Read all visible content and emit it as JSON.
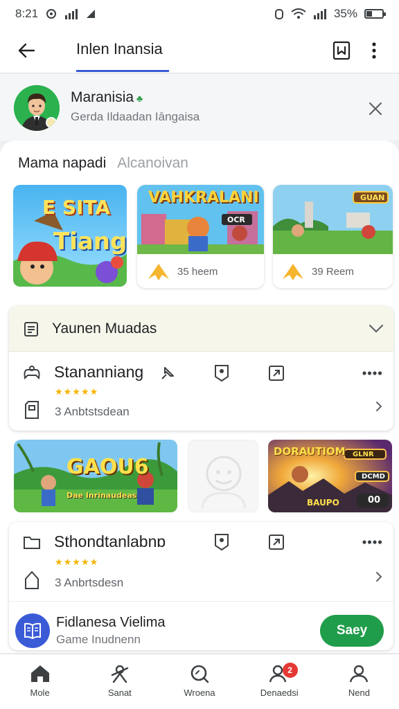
{
  "status_bar": {
    "time": "8:21",
    "battery": "35%",
    "battery_level": 0.35
  },
  "app_bar": {
    "title": "Inlen Inansia"
  },
  "profile": {
    "name": "Maranisia",
    "subtitle": "Gerda Ildaadan Iāngaisa"
  },
  "tabs": [
    {
      "label": "Mama napadi",
      "active": true
    },
    {
      "label": "Alcanoivan",
      "active": false
    }
  ],
  "featured": [
    {
      "title_line1": "E SITA",
      "title_line2": "Tiang"
    },
    {
      "title": "VAHKRALANI",
      "tag": "OCR",
      "rating": "35 heem"
    },
    {
      "tag": "GUAN",
      "rating": "39 Reem"
    }
  ],
  "section": {
    "header": "Yaunen Muadas"
  },
  "apps": [
    {
      "name": "Stananniang",
      "rating_stars": 5,
      "subtitle": "3 Anbtstsdean"
    },
    {
      "name": "Sthondtanlabnɒ",
      "rating_stars": 5,
      "subtitle": "3 Anbrtsdesn"
    }
  ],
  "gallery": [
    {
      "title": "GAOU6",
      "caption": "Dae Inrinaudeas"
    },
    {
      "title": ""
    },
    {
      "title": "DORAUTIOM",
      "tag": "GLNR",
      "tag2": "DCMD",
      "tag3": "BAUPO",
      "count": "00"
    }
  ],
  "promo": {
    "title": "Fidlanesa Vielima",
    "subtitle": "Game Inudnenn",
    "button": "Saey"
  },
  "bottom_nav": [
    {
      "label": "Mole",
      "icon": "home-icon"
    },
    {
      "label": "Sanat",
      "icon": "puzzle-icon"
    },
    {
      "label": "Wroena",
      "icon": "search-icon"
    },
    {
      "label": "Denaedsi",
      "icon": "friends-icon",
      "badge": "2"
    },
    {
      "label": "Nend",
      "icon": "profile-icon"
    }
  ],
  "colors": {
    "accent": "#3b5bd6",
    "green": "#1f9d4a",
    "badge": "#e53935",
    "star": "#f4b400"
  }
}
